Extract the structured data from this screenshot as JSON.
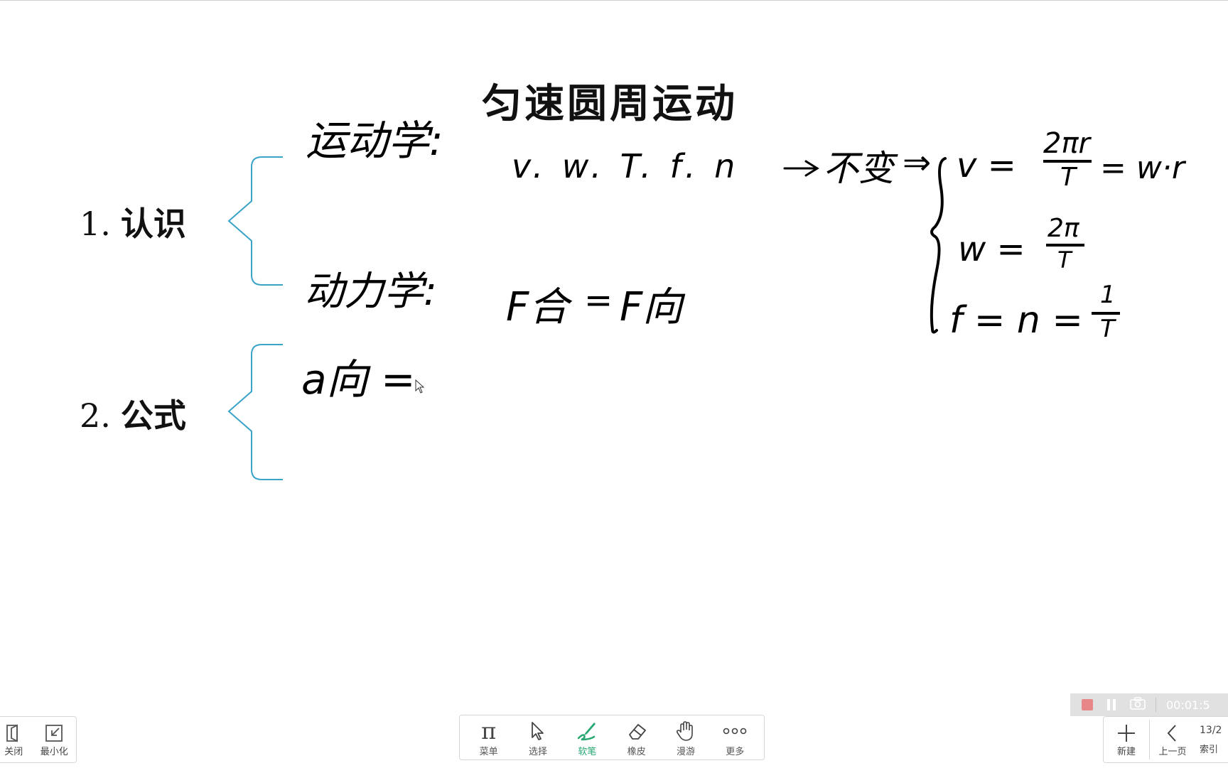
{
  "board": {
    "title": "匀速圆周运动",
    "sections": [
      {
        "number": "1.",
        "label": "认识"
      },
      {
        "number": "2.",
        "label": "公式"
      }
    ],
    "handwriting": {
      "kinematics_label": "运动学:",
      "kinematics_terms": "v. w. T. f. n",
      "unchanged": "不变",
      "implies": "⇒",
      "dynamics_label": "动力学:",
      "dynamics_formula_lhs": "F合",
      "dynamics_formula_rhs": "F向",
      "eq_v_lhs": "v =",
      "eq_v_num": "2πr",
      "eq_v_den": "T",
      "eq_v_tail": "= w·r",
      "eq_w_lhs": "w =",
      "eq_w_num": "2π",
      "eq_w_den": "T",
      "eq_f_lhs": "f = n =",
      "eq_f_num": "1",
      "eq_f_den": "T",
      "accel_lhs": "a向 ="
    }
  },
  "left_dock": {
    "close_label": "关闭",
    "minimize_label": "最小化"
  },
  "toolbar": {
    "items": [
      {
        "label": "菜单",
        "icon": "pi-icon"
      },
      {
        "label": "选择",
        "icon": "cursor-icon"
      },
      {
        "label": "软笔",
        "icon": "brush-icon",
        "active": true
      },
      {
        "label": "橡皮",
        "icon": "eraser-icon"
      },
      {
        "label": "漫游",
        "icon": "hand-icon"
      },
      {
        "label": "更多",
        "icon": "more-icon"
      }
    ],
    "active_color": "#2aa873"
  },
  "recorder": {
    "time": "00:01:5"
  },
  "right_dock": {
    "new_label": "新建",
    "prev_label": "上一页",
    "page_indicator": "13/2",
    "index_label": "索引"
  },
  "colors": {
    "brace": "#3aa3c8",
    "ink": "#000000"
  }
}
